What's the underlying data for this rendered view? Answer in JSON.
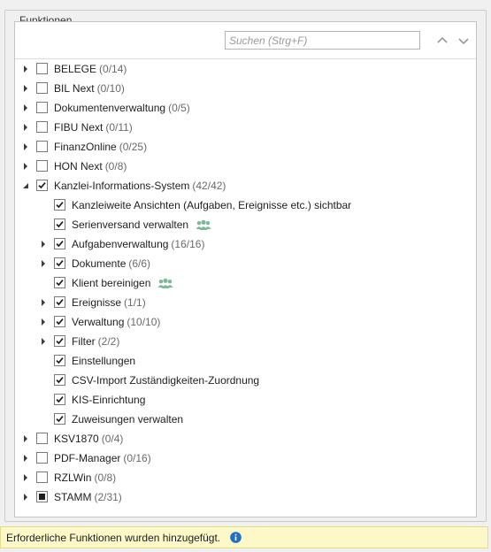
{
  "groupbox": {
    "title": "Funktionen"
  },
  "search": {
    "placeholder": "Suchen (Strg+F)",
    "value": ""
  },
  "tree": [
    {
      "level": 0,
      "expander": "collapsed",
      "check": "unchecked",
      "label": "BELEGE",
      "count": "(0/14)"
    },
    {
      "level": 0,
      "expander": "collapsed",
      "check": "unchecked",
      "label": "BIL Next",
      "count": "(0/10)"
    },
    {
      "level": 0,
      "expander": "collapsed",
      "check": "unchecked",
      "label": "Dokumentenverwaltung",
      "count": "(0/5)"
    },
    {
      "level": 0,
      "expander": "collapsed",
      "check": "unchecked",
      "label": "FIBU Next",
      "count": "(0/11)"
    },
    {
      "level": 0,
      "expander": "collapsed",
      "check": "unchecked",
      "label": "FinanzOnline",
      "count": "(0/25)"
    },
    {
      "level": 0,
      "expander": "collapsed",
      "check": "unchecked",
      "label": "HON Next",
      "count": "(0/8)"
    },
    {
      "level": 0,
      "expander": "expanded",
      "check": "checked",
      "label": "Kanzlei-Informations-System",
      "count": "(42/42)"
    },
    {
      "level": 1,
      "expander": "none",
      "check": "checked",
      "label": "Kanzleiweite Ansichten (Aufgaben, Ereignisse etc.) sichtbar",
      "count": ""
    },
    {
      "level": 1,
      "expander": "none",
      "check": "checked",
      "label": "Serienversand verwalten",
      "count": "",
      "icon": "user-group-icon"
    },
    {
      "level": 1,
      "expander": "collapsed",
      "check": "checked",
      "label": "Aufgabenverwaltung",
      "count": "(16/16)"
    },
    {
      "level": 1,
      "expander": "collapsed",
      "check": "checked",
      "label": "Dokumente",
      "count": "(6/6)"
    },
    {
      "level": 1,
      "expander": "none",
      "check": "checked",
      "label": "Klient bereinigen",
      "count": "",
      "icon": "user-group-icon"
    },
    {
      "level": 1,
      "expander": "collapsed",
      "check": "checked",
      "label": "Ereignisse",
      "count": "(1/1)"
    },
    {
      "level": 1,
      "expander": "collapsed",
      "check": "checked",
      "label": "Verwaltung",
      "count": "(10/10)"
    },
    {
      "level": 1,
      "expander": "collapsed",
      "check": "checked",
      "label": "Filter",
      "count": "(2/2)"
    },
    {
      "level": 1,
      "expander": "none",
      "check": "checked",
      "label": "Einstellungen",
      "count": ""
    },
    {
      "level": 1,
      "expander": "none",
      "check": "checked",
      "label": "CSV-Import Zuständigkeiten-Zuordnung",
      "count": ""
    },
    {
      "level": 1,
      "expander": "none",
      "check": "checked",
      "label": "KIS-Einrichtung",
      "count": ""
    },
    {
      "level": 1,
      "expander": "none",
      "check": "checked",
      "label": "Zuweisungen verwalten",
      "count": ""
    },
    {
      "level": 0,
      "expander": "collapsed",
      "check": "unchecked",
      "label": "KSV1870",
      "count": "(0/4)"
    },
    {
      "level": 0,
      "expander": "collapsed",
      "check": "unchecked",
      "label": "PDF-Manager",
      "count": "(0/16)"
    },
    {
      "level": 0,
      "expander": "collapsed",
      "check": "unchecked",
      "label": "RZLWin",
      "count": "(0/8)"
    },
    {
      "level": 0,
      "expander": "collapsed",
      "check": "indeterminate",
      "label": "STAMM",
      "count": "(2/31)"
    }
  ],
  "status": {
    "message": "Erforderliche Funktionen wurden hinzugefügt."
  },
  "colors": {
    "group_icon": "#7fb898",
    "info_icon": "#1f6fc5",
    "footer_bg": "#fcf8c8"
  }
}
